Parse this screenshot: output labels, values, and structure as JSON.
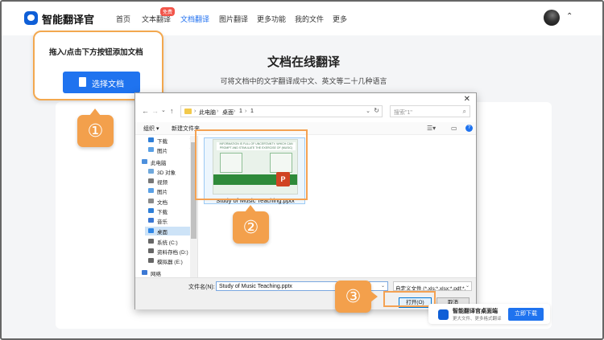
{
  "app": {
    "brand": "智能翻译官"
  },
  "nav": {
    "items": [
      "首页",
      "文本翻译",
      "文档翻译",
      "图片翻译",
      "更多功能",
      "我的文件",
      "更多"
    ],
    "badge": "免费",
    "active_index": 2
  },
  "hero": {
    "title": "文档在线翻译",
    "subtitle": "可将文档中的文字翻译成中文、英文等二十几种语言"
  },
  "callout": {
    "text": "拖入/点击下方按钮添加文档",
    "button": "选择文档"
  },
  "steps": [
    "①",
    "②",
    "③"
  ],
  "dialog": {
    "path": [
      "此电脑",
      "桌面",
      "1",
      "1"
    ],
    "search_placeholder": "搜索\"1\"",
    "toolbar": {
      "organize": "组织 ▾",
      "new_folder": "新建文件夹"
    },
    "sidebar": [
      {
        "label": "下载",
        "icon": "download-icon",
        "pinned": true
      },
      {
        "label": "图片",
        "icon": "picture-icon",
        "pinned": true
      },
      {
        "label": "此电脑",
        "icon": "computer-icon",
        "pinned": false
      },
      {
        "label": "3D 对象",
        "icon": "cube-icon",
        "pinned": false
      },
      {
        "label": "视频",
        "icon": "video-icon",
        "pinned": false
      },
      {
        "label": "图片",
        "icon": "picture-icon",
        "pinned": false
      },
      {
        "label": "文档",
        "icon": "document-icon",
        "pinned": false
      },
      {
        "label": "下载",
        "icon": "download-icon",
        "pinned": false
      },
      {
        "label": "音乐",
        "icon": "music-icon",
        "pinned": false
      },
      {
        "label": "桌面",
        "icon": "desktop-icon",
        "pinned": false
      },
      {
        "label": "系统 (C:)",
        "icon": "drive-icon",
        "pinned": false
      },
      {
        "label": "资料存档 (D:)",
        "icon": "drive-icon",
        "pinned": false
      },
      {
        "label": "模拟器 (E:)",
        "icon": "drive-icon",
        "pinned": false
      },
      {
        "label": "网络",
        "icon": "network-icon",
        "pinned": false
      }
    ],
    "sidebar_selected": 9,
    "file": {
      "name": "Study of Music Teaching.pptx",
      "thumb_title": "INFORMATION IS FULL OF UNCERTAINTY, WHICH CAN PROMPT AND STIMULATE THE EXERCISE OF (MUSIC)"
    },
    "filename_label": "文件名(N):",
    "filename_value": "Study of Music Teaching.pptx",
    "filetype_value": "自定义文件 (*.xls;*.xlsx;*.pdf;*.",
    "open_button": "打开(O)",
    "cancel_button": "取消"
  },
  "promo": {
    "title": "智能翻译官桌面端",
    "subtitle": "更大文件、更多格式翻译",
    "button": "立即下载"
  },
  "colors": {
    "accent": "#1f73ef",
    "highlight": "#f3a04c"
  }
}
